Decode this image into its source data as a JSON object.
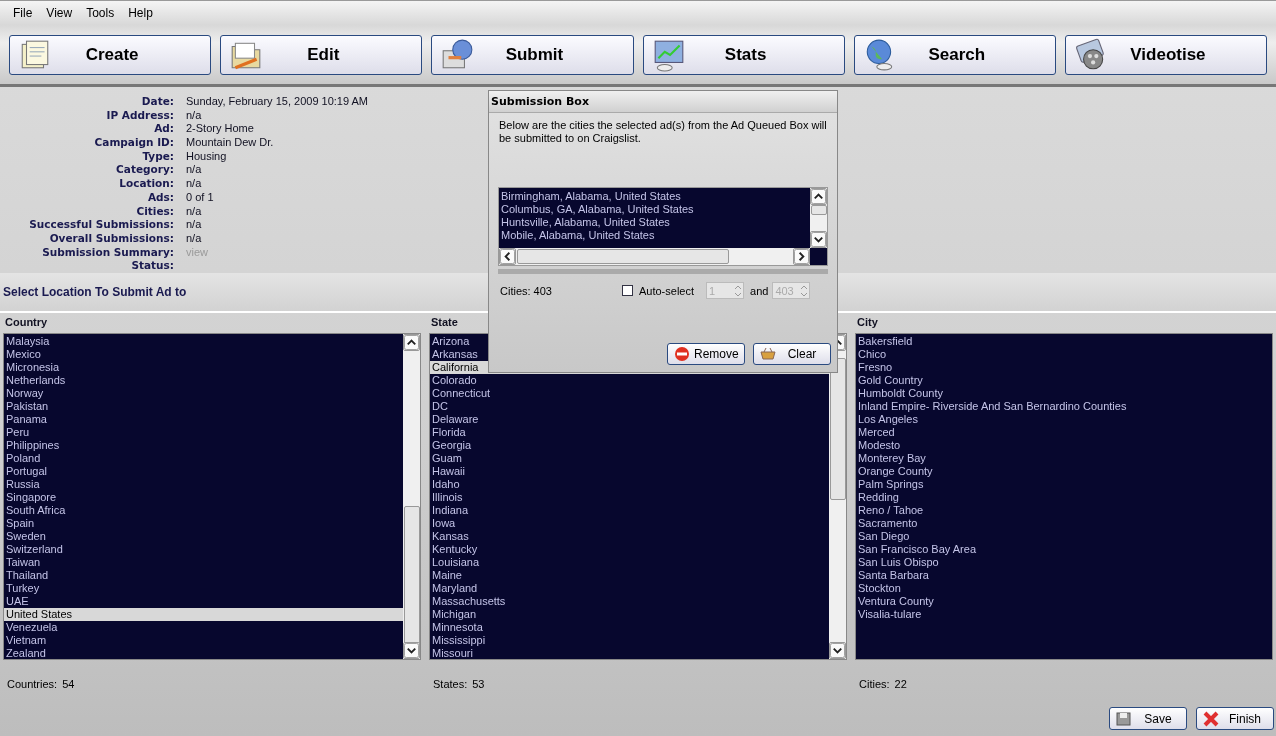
{
  "menu": [
    {
      "label": "File"
    },
    {
      "label": "View"
    },
    {
      "label": "Tools"
    },
    {
      "label": "Help"
    }
  ],
  "toolbar": [
    {
      "label": "Create"
    },
    {
      "label": "Edit"
    },
    {
      "label": "Submit"
    },
    {
      "label": "Stats"
    },
    {
      "label": "Search"
    },
    {
      "label": "Videotise"
    }
  ],
  "info": [
    {
      "label": "Date:",
      "value": "Sunday, February 15, 2009 10:19 AM",
      "kind": "text"
    },
    {
      "label": "IP Address:",
      "value": "n/a",
      "kind": "text"
    },
    {
      "label": "Ad:",
      "value": "2-Story Home",
      "kind": "text"
    },
    {
      "label": "Campaign ID:",
      "value": "Mountain Dew Dr.",
      "kind": "text"
    },
    {
      "label": "Type:",
      "value": "Housing",
      "kind": "text"
    },
    {
      "label": "Category:",
      "value": "n/a",
      "kind": "text"
    },
    {
      "label": "Location:",
      "value": "n/a",
      "kind": "text"
    },
    {
      "label": "Ads:",
      "value": "0 of 1",
      "kind": "text"
    },
    {
      "label": "Cities:",
      "value": "n/a",
      "kind": "text"
    },
    {
      "label": "Successful Submissions:",
      "value": "n/a",
      "kind": "text"
    },
    {
      "label": "Overall Submissions:",
      "value": "n/a",
      "kind": "text"
    },
    {
      "label": "Submission Summary:",
      "value": "view",
      "kind": "link",
      "disabled": true
    },
    {
      "label": "Status:",
      "kind": "text"
    }
  ],
  "section_title": "Select Location To Submit Ad to",
  "columns": [
    {
      "header": "Country",
      "count_label": "Countries:",
      "count": "54",
      "items": [
        {
          "label": "Malaysia",
          "selected": false
        },
        {
          "label": "Mexico",
          "selected": false
        },
        {
          "label": "Micronesia",
          "selected": false
        },
        {
          "label": "Netherlands",
          "selected": false
        },
        {
          "label": "Norway",
          "selected": false
        },
        {
          "label": "Pakistan",
          "selected": false
        },
        {
          "label": "Panama",
          "selected": false
        },
        {
          "label": "Peru",
          "selected": false
        },
        {
          "label": "Philippines",
          "selected": false
        },
        {
          "label": "Poland",
          "selected": false
        },
        {
          "label": "Portugal",
          "selected": false
        },
        {
          "label": "Russia",
          "selected": false
        },
        {
          "label": "Singapore",
          "selected": false
        },
        {
          "label": "South Africa",
          "selected": false
        },
        {
          "label": "Spain",
          "selected": false
        },
        {
          "label": "Sweden",
          "selected": false
        },
        {
          "label": "Switzerland",
          "selected": false
        },
        {
          "label": "Taiwan",
          "selected": false
        },
        {
          "label": "Thailand",
          "selected": false
        },
        {
          "label": "Turkey",
          "selected": false
        },
        {
          "label": "UAE",
          "selected": false
        },
        {
          "label": "United States",
          "selected": true
        },
        {
          "label": "Venezuela",
          "selected": false
        },
        {
          "label": "Vietnam",
          "selected": false
        },
        {
          "label": "Zealand",
          "selected": false
        }
      ]
    },
    {
      "header": "State",
      "count_label": "States:",
      "count": "53",
      "items": [
        {
          "label": "Arizona",
          "selected": false
        },
        {
          "label": "Arkansas",
          "selected": false
        },
        {
          "label": "California",
          "selected": true
        },
        {
          "label": "Colorado",
          "selected": false
        },
        {
          "label": "Connecticut",
          "selected": false
        },
        {
          "label": "DC",
          "selected": false
        },
        {
          "label": "Delaware",
          "selected": false
        },
        {
          "label": "Florida",
          "selected": false
        },
        {
          "label": "Georgia",
          "selected": false
        },
        {
          "label": "Guam",
          "selected": false
        },
        {
          "label": "Hawaii",
          "selected": false
        },
        {
          "label": "Idaho",
          "selected": false
        },
        {
          "label": "Illinois",
          "selected": false
        },
        {
          "label": "Indiana",
          "selected": false
        },
        {
          "label": "Iowa",
          "selected": false
        },
        {
          "label": "Kansas",
          "selected": false
        },
        {
          "label": "Kentucky",
          "selected": false
        },
        {
          "label": "Louisiana",
          "selected": false
        },
        {
          "label": "Maine",
          "selected": false
        },
        {
          "label": "Maryland",
          "selected": false
        },
        {
          "label": "Massachusetts",
          "selected": false
        },
        {
          "label": "Michigan",
          "selected": false
        },
        {
          "label": "Minnesota",
          "selected": false
        },
        {
          "label": "Mississippi",
          "selected": false
        },
        {
          "label": "Missouri",
          "selected": false
        }
      ]
    },
    {
      "header": "City",
      "count_label": "Cities:",
      "count": "22",
      "items": [
        {
          "label": "Bakersfield",
          "selected": false
        },
        {
          "label": "Chico",
          "selected": false
        },
        {
          "label": "Fresno",
          "selected": false
        },
        {
          "label": "Gold Country",
          "selected": false
        },
        {
          "label": "Humboldt County",
          "selected": false
        },
        {
          "label": "Inland Empire- Riverside And San Bernardino Counties",
          "selected": false
        },
        {
          "label": "Los Angeles",
          "selected": false
        },
        {
          "label": "Merced",
          "selected": false
        },
        {
          "label": "Modesto",
          "selected": false
        },
        {
          "label": "Monterey Bay",
          "selected": false
        },
        {
          "label": "Orange County",
          "selected": false
        },
        {
          "label": "Palm Springs",
          "selected": false
        },
        {
          "label": "Redding",
          "selected": false
        },
        {
          "label": "Reno / Tahoe",
          "selected": false
        },
        {
          "label": "Sacramento",
          "selected": false
        },
        {
          "label": "San Diego",
          "selected": false
        },
        {
          "label": "San Francisco Bay Area",
          "selected": false
        },
        {
          "label": "San Luis Obispo",
          "selected": false
        },
        {
          "label": "Santa Barbara",
          "selected": false
        },
        {
          "label": "Stockton",
          "selected": false
        },
        {
          "label": "Ventura County",
          "selected": false
        },
        {
          "label": "Visalia-tulare",
          "selected": false
        }
      ]
    }
  ],
  "dialog": {
    "title": "Submission Box",
    "message": "Below are the cities the selected ad(s) from the Ad Queued Box will be submitted to on Craigslist.",
    "cities": [
      "Birmingham, Alabama, United States",
      "Columbus, GA, Alabama, United States",
      "Huntsville, Alabama, United States",
      "Mobile, Alabama, United States"
    ],
    "cities_count": "Cities: 403",
    "auto_select": {
      "label": "Auto-select",
      "checked": false
    },
    "range_from": {
      "value": "1",
      "disabled": true
    },
    "range_joiner": "and",
    "range_to": {
      "value": "403",
      "disabled": true
    },
    "buttons": [
      {
        "label": "Remove"
      },
      {
        "label": "Clear"
      }
    ]
  },
  "footer_buttons": [
    {
      "label": "Save"
    },
    {
      "label": "Finish"
    }
  ]
}
